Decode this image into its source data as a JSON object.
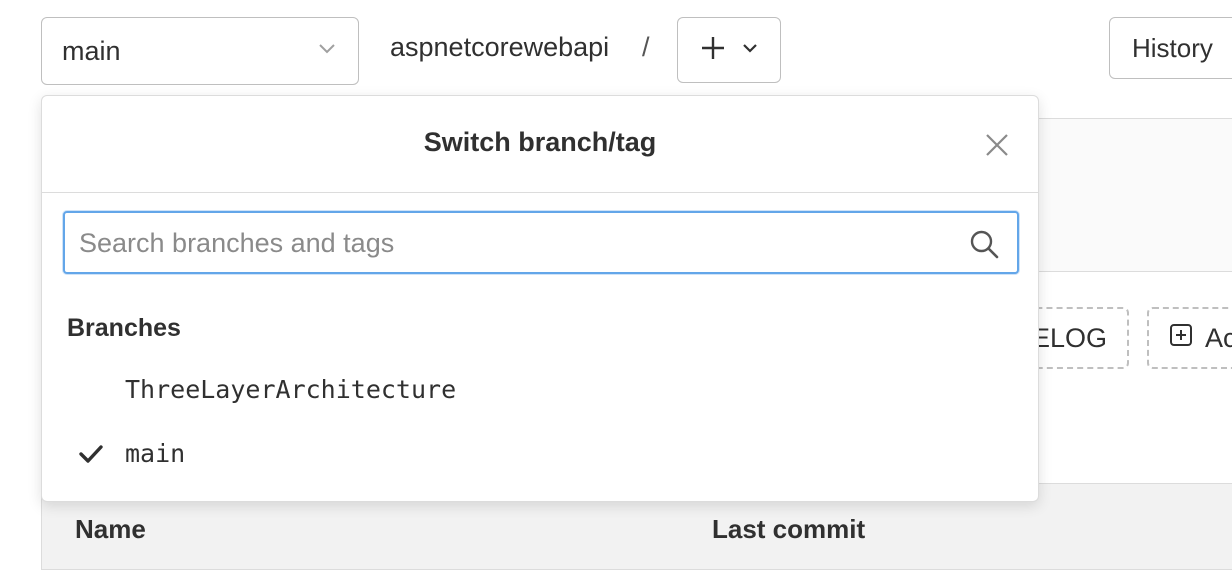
{
  "toolbar": {
    "branch_selector": {
      "value": "main"
    },
    "project_breadcrumb": "aspnetcorewebapi",
    "breadcrumb_separator": "/",
    "add_button_icon": "plus-icon",
    "history_label": "History"
  },
  "background": {
    "changelog_label": "ELOG",
    "add_file_label": "Ac",
    "table_headers": [
      "Name",
      "Last commit"
    ]
  },
  "branch_dropdown": {
    "title": "Switch branch/tag",
    "search": {
      "value": "",
      "placeholder": "Search branches and tags"
    },
    "sections": [
      {
        "header": "Branches",
        "items": [
          {
            "label": "ThreeLayerArchitecture",
            "selected": false
          },
          {
            "label": "main",
            "selected": true
          }
        ]
      }
    ]
  },
  "colors": {
    "focus_ring": "#63a6e9",
    "border": "#bfbfbf",
    "text": "#303030",
    "placeholder": "#8a8a8a"
  }
}
